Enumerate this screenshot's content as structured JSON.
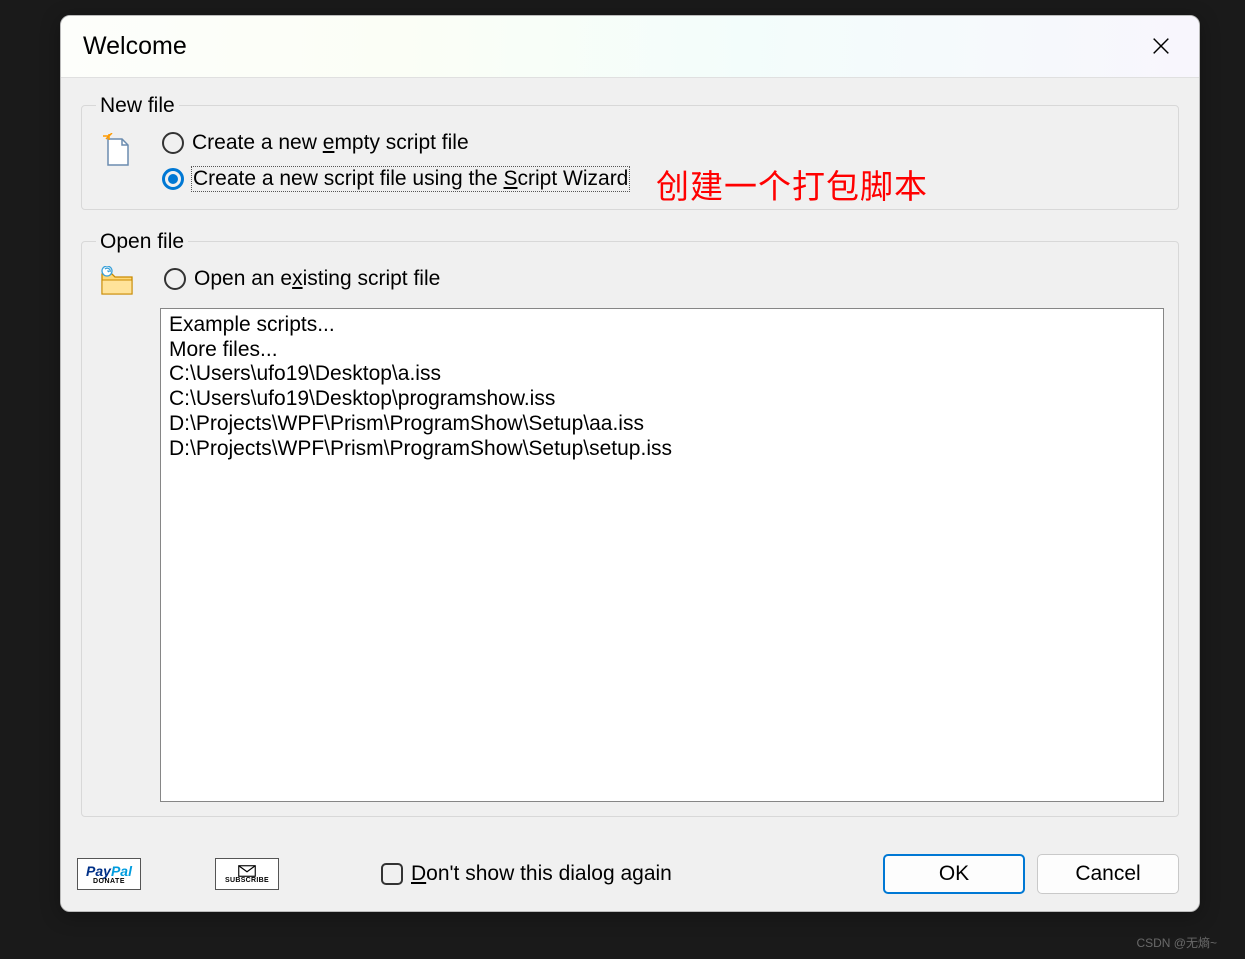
{
  "dialog": {
    "title": "Welcome"
  },
  "new_file": {
    "legend": "New file",
    "option_empty": {
      "pre": "Create a new ",
      "u": "e",
      "post": "mpty script file"
    },
    "option_wizard": {
      "pre": "Create a new script file using the ",
      "u": "S",
      "post": "cript Wizard"
    }
  },
  "annotation": "创建一个打包脚本",
  "open_file": {
    "legend": "Open file",
    "option_open": {
      "pre": "Open an e",
      "u": "x",
      "post": "isting script file"
    },
    "items": [
      "Example scripts...",
      "More files...",
      "C:\\Users\\ufo19\\Desktop\\a.iss",
      "C:\\Users\\ufo19\\Desktop\\programshow.iss",
      "D:\\Projects\\WPF\\Prism\\ProgramShow\\Setup\\aa.iss",
      "D:\\Projects\\WPF\\Prism\\ProgramShow\\Setup\\setup.iss"
    ]
  },
  "footer": {
    "paypal_brand1": "Pay",
    "paypal_brand2": "Pal",
    "paypal_sub": "DONATE",
    "subscribe_sub": "SUBSCRIBE",
    "dont_show": {
      "pre": "",
      "u": "D",
      "post": "on't show this dialog again"
    },
    "ok": "OK",
    "cancel": "Cancel"
  },
  "watermark": "CSDN @无熵~"
}
